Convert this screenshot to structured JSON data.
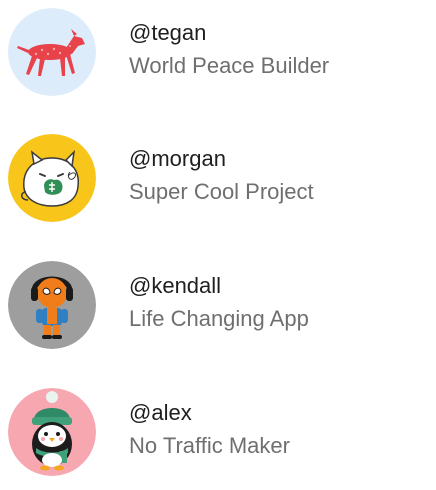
{
  "users": [
    {
      "handle": "@tegan",
      "project": "World Peace Builder",
      "avatar_icon": "red-dog-icon",
      "avatar_bg": "#dcecfb"
    },
    {
      "handle": "@morgan",
      "project": "Super Cool Project",
      "avatar_icon": "cat-holding-money-icon",
      "avatar_bg": "#f8c61a"
    },
    {
      "handle": "@kendall",
      "project": "Life Changing App",
      "avatar_icon": "spider-hero-headphones-icon",
      "avatar_bg": "#9e9e9e"
    },
    {
      "handle": "@alex",
      "project": "No Traffic Maker",
      "avatar_icon": "penguin-beanie-icon",
      "avatar_bg": "#f6a7b0"
    }
  ],
  "colors": {
    "handle_text": "#1f1f1f",
    "subtitle_text": "#6f6f6f",
    "background": "#ffffff"
  }
}
